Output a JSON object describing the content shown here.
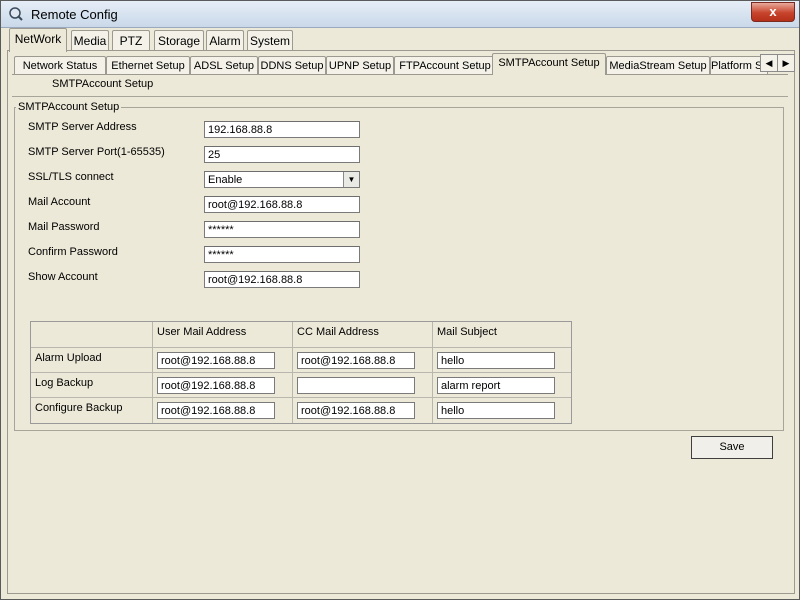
{
  "window": {
    "title": "Remote Config",
    "close_label": "x"
  },
  "top_tabs": [
    "NetWork",
    "Media",
    "PTZ",
    "Storage",
    "Alarm",
    "System"
  ],
  "second_tabs": [
    "Network Status",
    "Ethernet Setup",
    "ADSL Setup",
    "DDNS Setup",
    "UPNP Setup",
    "FTPAccount Setup",
    "SMTPAccount Setup",
    "MediaStream Setup",
    "Platform Se"
  ],
  "scroll_buttons": {
    "left": "◀",
    "right": "▶"
  },
  "sub_tab_label": "SMTPAccount Setup",
  "group": {
    "title": "SMTPAccount Setup",
    "fields": [
      {
        "label": "SMTP Server Address",
        "value": "192.168.88.8"
      },
      {
        "label": "SMTP Server Port(1-65535)",
        "value": "25"
      },
      {
        "label": "SSL/TLS connect",
        "value": "Enable",
        "type": "select"
      },
      {
        "label": "Mail Account",
        "value": "root@192.168.88.8"
      },
      {
        "label": "Mail Password",
        "value": "******"
      },
      {
        "label": "Confirm Password",
        "value": "******"
      },
      {
        "label": "Show Account",
        "value": "root@192.168.88.8"
      }
    ]
  },
  "table": {
    "headers": [
      "",
      "User Mail Address",
      "CC Mail Address",
      "Mail Subject"
    ],
    "rows": [
      {
        "name": "Alarm Upload",
        "user": "root@192.168.88.8",
        "cc": "root@192.168.88.8",
        "subject": "hello"
      },
      {
        "name": "Log Backup",
        "user": "root@192.168.88.8",
        "cc": "",
        "subject": "alarm report"
      },
      {
        "name": "Configure Backup",
        "user": "root@192.168.88.8",
        "cc": "root@192.168.88.8",
        "subject": "hello"
      }
    ]
  },
  "save_label": "Save",
  "select_arrow": "▼"
}
